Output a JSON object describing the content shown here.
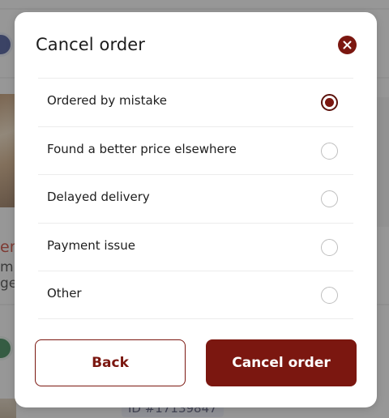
{
  "background": {
    "snippet_heading": "en",
    "snippet_line1": "m",
    "snippet_line2": "ge",
    "order_id": "ID #17139847"
  },
  "modal": {
    "title": "Cancel order",
    "close_icon": "close-icon",
    "reasons": [
      {
        "label": "Ordered by mistake",
        "selected": true
      },
      {
        "label": "Found a better price elsewhere",
        "selected": false
      },
      {
        "label": "Delayed delivery",
        "selected": false
      },
      {
        "label": "Payment issue",
        "selected": false
      },
      {
        "label": "Other",
        "selected": false
      }
    ],
    "back_label": "Back",
    "cancel_label": "Cancel order"
  },
  "colors": {
    "accent": "#7b1710",
    "overlay": "rgba(60,60,60,0.5)"
  }
}
